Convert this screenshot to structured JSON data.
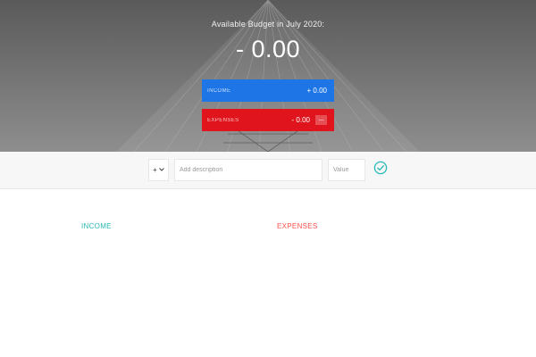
{
  "budget": {
    "title": "Available Budget in July 2020:",
    "value": "- 0.00",
    "income": {
      "label": "Income",
      "value": "+ 0.00",
      "color": "#1d75e6"
    },
    "expenses": {
      "label": "Expenses",
      "value": "- 0.00",
      "percentage": "---",
      "color": "#e0141c"
    }
  },
  "add": {
    "type_selected": "+",
    "type_icon": "chevron-down-icon",
    "description_placeholder": "Add description",
    "value_placeholder": "Value",
    "submit_icon": "check-circle-icon",
    "submit_color": "#28b9b5"
  },
  "lists": {
    "income_title": "Income",
    "income_color": "#28b9b5",
    "expenses_title": "Expenses",
    "expenses_color": "#ff5049"
  }
}
